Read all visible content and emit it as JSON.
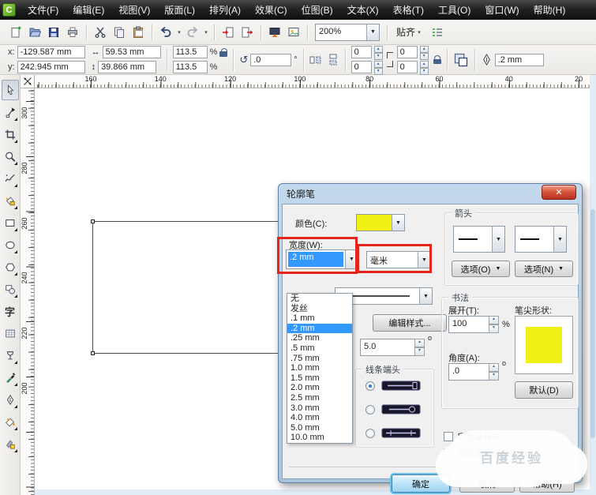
{
  "menu": {
    "items": [
      "文件(F)",
      "编辑(E)",
      "视图(V)",
      "版面(L)",
      "排列(A)",
      "效果(C)",
      "位图(B)",
      "文本(X)",
      "表格(T)",
      "工具(O)",
      "窗口(W)",
      "帮助(H)"
    ]
  },
  "toolbar": {
    "buttons": [
      "new",
      "open",
      "save",
      "print",
      "sep",
      "cut",
      "copy",
      "paste",
      "sep",
      "undo",
      "caret",
      "redo",
      "caret",
      "sep",
      "import",
      "export",
      "sep",
      "app-launcher",
      "preview",
      "sep"
    ],
    "zoom_value": "200%",
    "snap_label": "贴齐"
  },
  "propbar": {
    "x_label": "x:",
    "x_value": "-129.587 mm",
    "y_label": "y:",
    "y_value": "242.945 mm",
    "width_value": "59.53 mm",
    "height_value": "39.866 mm",
    "scale_h": "113.5",
    "scale_v": "113.5",
    "percent": "%",
    "angle_value": ".0",
    "degree": "°",
    "corner_1": "0",
    "corner_2": "0",
    "corner_3": "0",
    "corner_4": "0",
    "outline_width": ".2 mm"
  },
  "rulers": {
    "h_labels": [
      "160",
      "140",
      "120",
      "100",
      "80",
      "60",
      "40",
      "20"
    ],
    "v_labels": [
      "300",
      "280",
      "260",
      "240",
      "220",
      "200"
    ]
  },
  "toolbox": {
    "tools": [
      "pick",
      "shape-edit",
      "crop",
      "zoom",
      "freehand",
      "smart-fill",
      "rectangle",
      "ellipse",
      "polygon",
      "basic-shapes",
      "text",
      "table",
      "effects",
      "eyedropper",
      "outline-pen",
      "fill",
      "interactive-fill"
    ]
  },
  "dialog": {
    "title": "轮廓笔",
    "color_label": "颜色(C):",
    "width_label": "宽度(W):",
    "width_value": ".2 mm",
    "unit_value": "毫米",
    "arrows_group": "箭头",
    "options_o": "选项(O)",
    "options_n": "选项(N)",
    "edit_style": "编辑样式...",
    "miter_value": "5.0",
    "miter_degree": "o",
    "caps_group": "线条端头",
    "calligraphy_group": "书法",
    "stretch_label": "展开(T):",
    "stretch_value": "100",
    "percent": "%",
    "angle_label": "角度(A):",
    "angle_value": ".0",
    "angle_degree": "o",
    "nib_label": "笔尖形状:",
    "default_button": "默认(D)",
    "behind_fill": "后台填充(B)",
    "scale_with_image": "按图像比例显示(M)",
    "ok": "确定",
    "cancel": "取消",
    "help": "帮助(H)",
    "close_glyph": "✕",
    "width_list": {
      "items": [
        "无",
        "发丝",
        ".1 mm",
        ".2 mm",
        ".25 mm",
        ".5 mm",
        ".75 mm",
        "1.0 mm",
        "1.5 mm",
        "2.0 mm",
        "2.5 mm",
        "3.0 mm",
        "4.0 mm",
        "5.0 mm",
        "10.0 mm"
      ],
      "selected": ".2 mm"
    },
    "accent_yellow": "#f0f015",
    "selection_blue": "#3399ff",
    "annotation_red": "#e5251b"
  },
  "watermark": {
    "text": "百度经验"
  }
}
